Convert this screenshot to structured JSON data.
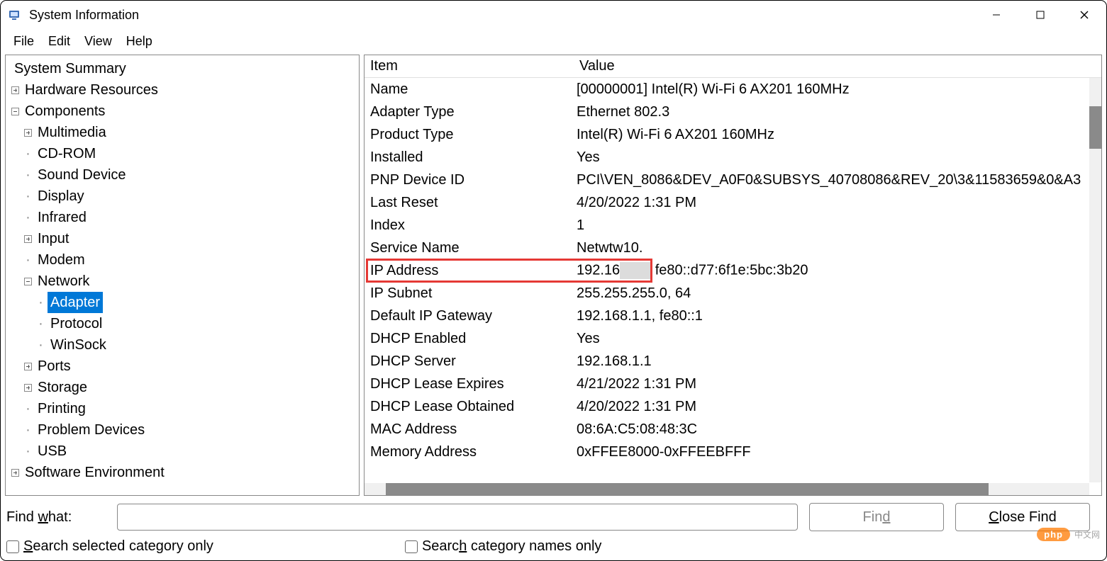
{
  "window": {
    "title": "System Information"
  },
  "menu": {
    "file": "File",
    "edit": "Edit",
    "view": "View",
    "help": "Help"
  },
  "tree": {
    "system_summary": "System Summary",
    "hardware_resources": "Hardware Resources",
    "components": "Components",
    "multimedia": "Multimedia",
    "cdrom": "CD-ROM",
    "sound_device": "Sound Device",
    "display": "Display",
    "infrared": "Infrared",
    "input": "Input",
    "modem": "Modem",
    "network": "Network",
    "adapter": "Adapter",
    "protocol": "Protocol",
    "winsock": "WinSock",
    "ports": "Ports",
    "storage": "Storage",
    "printing": "Printing",
    "problem_devices": "Problem Devices",
    "usb": "USB",
    "software_environment": "Software Environment"
  },
  "grid": {
    "headers": {
      "item": "Item",
      "value": "Value"
    },
    "rows": [
      {
        "item": "Name",
        "value": "[00000001] Intel(R) Wi-Fi 6 AX201 160MHz"
      },
      {
        "item": "Adapter Type",
        "value": "Ethernet 802.3"
      },
      {
        "item": "Product Type",
        "value": "Intel(R) Wi-Fi 6 AX201 160MHz"
      },
      {
        "item": "Installed",
        "value": "Yes"
      },
      {
        "item": "PNP Device ID",
        "value": "PCI\\VEN_8086&DEV_A0F0&SUBSYS_40708086&REV_20\\3&11583659&0&A3"
      },
      {
        "item": "Last Reset",
        "value": "4/20/2022 1:31 PM"
      },
      {
        "item": "Index",
        "value": "1"
      },
      {
        "item": "Service Name",
        "value": "Netwtw10."
      }
    ],
    "ip_row": {
      "item": "IP Address",
      "visible": "192.16",
      "rest": "fe80::d77:6f1e:5bc:3b20"
    },
    "rows_after": [
      {
        "item": "IP Subnet",
        "value": "255.255.255.0, 64"
      },
      {
        "item": "Default IP Gateway",
        "value": "192.168.1.1, fe80::1"
      },
      {
        "item": "DHCP Enabled",
        "value": "Yes"
      },
      {
        "item": "DHCP Server",
        "value": "192.168.1.1"
      },
      {
        "item": "DHCP Lease Expires",
        "value": "4/21/2022 1:31 PM"
      },
      {
        "item": "DHCP Lease Obtained",
        "value": "4/20/2022 1:31 PM"
      },
      {
        "item": "MAC Address",
        "value": "08:6A:C5:08:48:3C"
      },
      {
        "item": "Memory Address",
        "value": "0xFFEE8000-0xFFEEBFFF"
      }
    ]
  },
  "find": {
    "label_html": "Find what:",
    "find_btn": "Find",
    "close_btn": "Close Find",
    "opt_selected": "Search selected category only",
    "opt_names": "Search category names only"
  },
  "watermark": {
    "tag": "php",
    "txt": "中文网"
  }
}
